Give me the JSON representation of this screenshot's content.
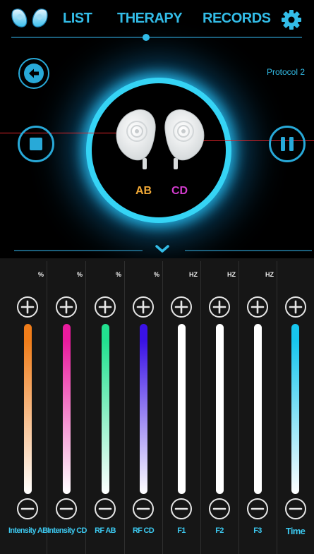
{
  "nav": {
    "tabs": [
      {
        "label": "LIST"
      },
      {
        "label": "THERAPY"
      },
      {
        "label": "RECORDS"
      }
    ],
    "active_tab": "THERAPY",
    "accent_color": "#33bde8"
  },
  "device": {
    "protocol_label": "Protocol 2",
    "channel_ab": "AB",
    "channel_cd": "CD",
    "channel_ab_color": "#f0a836",
    "channel_cd_color": "#d43ccf"
  },
  "controls": {
    "back_icon": "arrow-left-icon",
    "stop_icon": "stop-icon",
    "pause_icon": "pause-icon",
    "expand_icon": "chevron-down-icon",
    "settings_icon": "gear-icon"
  },
  "sliders": [
    {
      "label": "Intensity AB",
      "unit": "%",
      "color": "#f07d1a"
    },
    {
      "label": "Intensity CD",
      "unit": "%",
      "color": "#ea1b9e"
    },
    {
      "label": "RF AB",
      "unit": "%",
      "color": "#22e08f"
    },
    {
      "label": "RF CD",
      "unit": "%",
      "color": "#3a12e6"
    },
    {
      "label": "F1",
      "unit": "HZ",
      "color": "#ffffff"
    },
    {
      "label": "F2",
      "unit": "HZ",
      "color": "#ffffff"
    },
    {
      "label": "F3",
      "unit": "HZ",
      "color": "#ffffff"
    },
    {
      "label": "Time",
      "unit": "",
      "color": "#17c6ee"
    }
  ]
}
